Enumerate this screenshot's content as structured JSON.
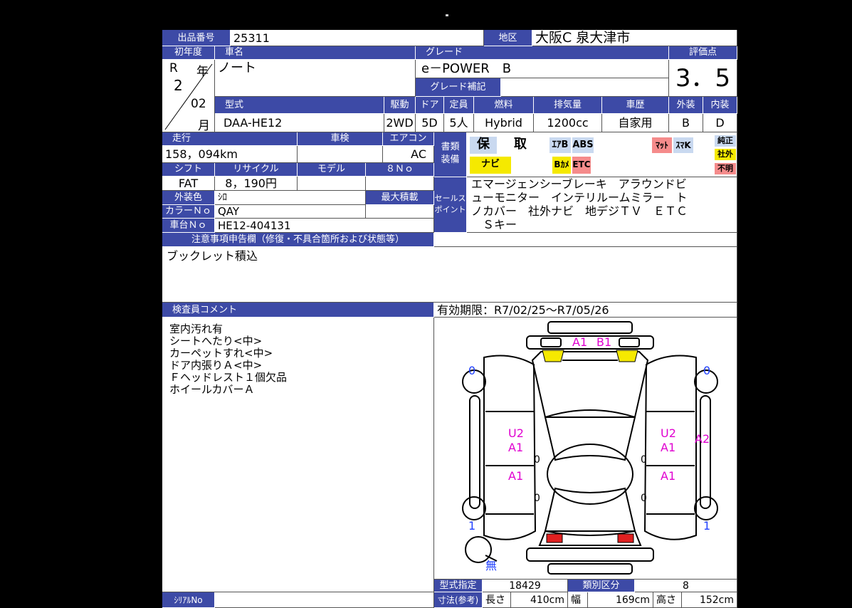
{
  "header": {
    "lot_label": "出品番号",
    "lot_value": "25311",
    "region_label": "地区",
    "region_value": "大阪C 泉大津市"
  },
  "first_reg": {
    "label": "初年度",
    "era": "R",
    "year_mark": "年",
    "year": "2",
    "month": "02",
    "month_mark": "月"
  },
  "car": {
    "name_label": "車名",
    "name": "ノート"
  },
  "grade": {
    "label": "グレード",
    "value": "e－POWER　B",
    "supplement_label": "グレード補記",
    "supplement_value": ""
  },
  "score": {
    "label": "評価点",
    "value": "3．5"
  },
  "specs": {
    "model_label": "型式",
    "model": "DAA-HE12",
    "drive_label": "駆動",
    "drive": "2WD",
    "doors_label": "ドア",
    "doors": "5D",
    "capacity_label": "定員",
    "capacity": "5人",
    "fuel_label": "燃料",
    "fuel": "Hybrid",
    "displacement_label": "排気量",
    "displacement": "1200cc",
    "history_label": "車歴",
    "history": "自家用",
    "exterior_label": "外装",
    "exterior": "B",
    "interior_label": "内装",
    "interior": "D"
  },
  "mileage": {
    "label": "走行",
    "value": "158，094km"
  },
  "inspection": {
    "label": "車検",
    "value": ""
  },
  "aircon": {
    "label": "エアコン",
    "value": "AC"
  },
  "docs": {
    "label1": "書類",
    "label2": "装備"
  },
  "badges": {
    "warranty": "保",
    "manual": "取",
    "airbag": "ｴｱB",
    "abs": "ABS",
    "mat": "ﾏｯﾄ",
    "smartkey": "ｽﾏK",
    "navi": "ナビ",
    "bcam": "Bｶﾒ",
    "etc": "ETC",
    "genuine": "純正",
    "aftermarket": "社外",
    "unknown": "不明"
  },
  "shift": {
    "label": "シフト",
    "value": "FAT"
  },
  "recycle": {
    "label": "リサイクル",
    "value": "8，190円"
  },
  "model_year": {
    "label": "モデル",
    "value": ""
  },
  "eight_no": {
    "label": "８Ｎｏ",
    "value": ""
  },
  "color": {
    "label": "外装色",
    "value": "ｼﾛ"
  },
  "max_load": {
    "label": "最大積載",
    "value": ""
  },
  "color_no": {
    "label": "カラーＮｏ",
    "value": "QAY"
  },
  "chassis": {
    "label": "車台Ｎｏ",
    "value": "HE12-404131"
  },
  "sales_points": {
    "label1": "セールス",
    "label2": "ポイント",
    "lines": [
      "エマージェンシーブレーキ　アラウンドビ",
      "ューモニター　インテリルームミラー　ト",
      "ノカバー　社外ナビ　地デジＴＶ　ＥＴＣ",
      "　Ｓキー"
    ]
  },
  "notes": {
    "label": "注意事項申告欄（修復・不具合箇所および状態等）",
    "value": "ブックレット積込"
  },
  "inspector": {
    "label": "検査員コメント",
    "lines": [
      "室内汚れ有",
      "シートへたり<中>",
      "カーペットすれ<中>",
      "ドア内張りＡ<中>",
      "Ｆヘッドレスト１個欠品",
      "ホイールカバーＡ"
    ]
  },
  "validity": "有効期限：R7/02/25～R7/05/26",
  "diagram": {
    "marks": [
      "A1",
      "B1",
      "U2",
      "A1",
      "A1",
      "U2",
      "A1",
      "A2",
      "A1"
    ],
    "tire_depths": [
      "0",
      "0",
      "1",
      "1"
    ],
    "zeros": [
      "0",
      "0",
      "0",
      "0"
    ],
    "spare": "無"
  },
  "type_designation": {
    "label": "型式指定",
    "value": "18429"
  },
  "class_division": {
    "label": "類別区分",
    "value": "8"
  },
  "dimensions": {
    "label": "寸法(参考)",
    "length_label": "長さ",
    "length": "410cm",
    "width_label": "幅",
    "width": "169cm",
    "height_label": "高さ",
    "height": "152cm"
  },
  "serial": {
    "label": "ｼﾘｱﾙNo",
    "value": ""
  },
  "colors": {
    "header_blue": "#3d4aa6",
    "badge_blue": "#c9d9f0",
    "badge_yellow": "#f5e900",
    "badge_red": "#f58b8b",
    "mark_magenta": "#e000d0",
    "depth_blue": "#2040ff"
  }
}
